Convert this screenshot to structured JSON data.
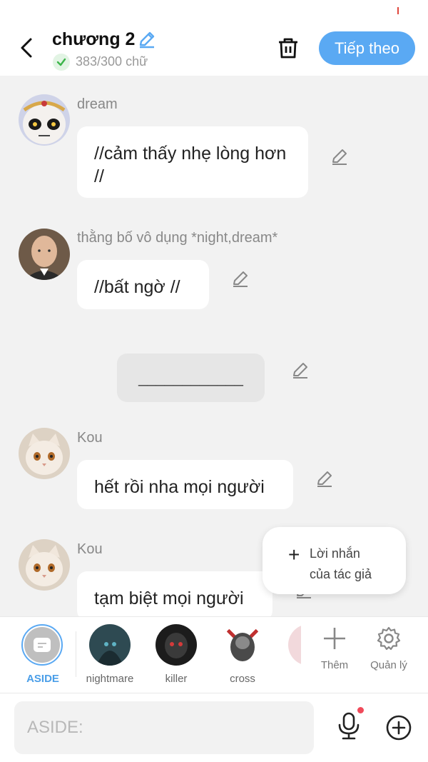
{
  "header": {
    "title": "chương 2",
    "word_count": "383/300 chữ",
    "next_label": "Tiếp theo"
  },
  "messages": [
    {
      "author": "dream",
      "text": "//cảm thấy nhẹ lòng hơn //",
      "avatar": "skull-mask-avatar"
    },
    {
      "author": "thằng bố vô dụng *night,dream*",
      "text": "//bất ngờ //",
      "avatar": "bald-man-avatar"
    },
    {
      "type": "divider",
      "text": "____________"
    },
    {
      "author": "Kou",
      "text": "hết rồi nha mọi người",
      "avatar": "cat-avatar"
    },
    {
      "author": "Kou",
      "text": "tạm biệt mọi người",
      "avatar": "cat-avatar"
    }
  ],
  "popup": {
    "plus": "+",
    "text": "Lời nhắn\ncủa tác giả"
  },
  "characters": [
    {
      "label": "ASIDE",
      "active": true
    },
    {
      "label": "nightmare"
    },
    {
      "label": "killer"
    },
    {
      "label": "cross"
    },
    {
      "label": ""
    }
  ],
  "tools": {
    "add_label": "Thêm",
    "manage_label": "Quản lý"
  },
  "input": {
    "placeholder": "ASIDE:"
  },
  "colors": {
    "accent": "#5aa9f3",
    "background": "#f2f2f2",
    "notification_dot": "#f04a5a"
  }
}
